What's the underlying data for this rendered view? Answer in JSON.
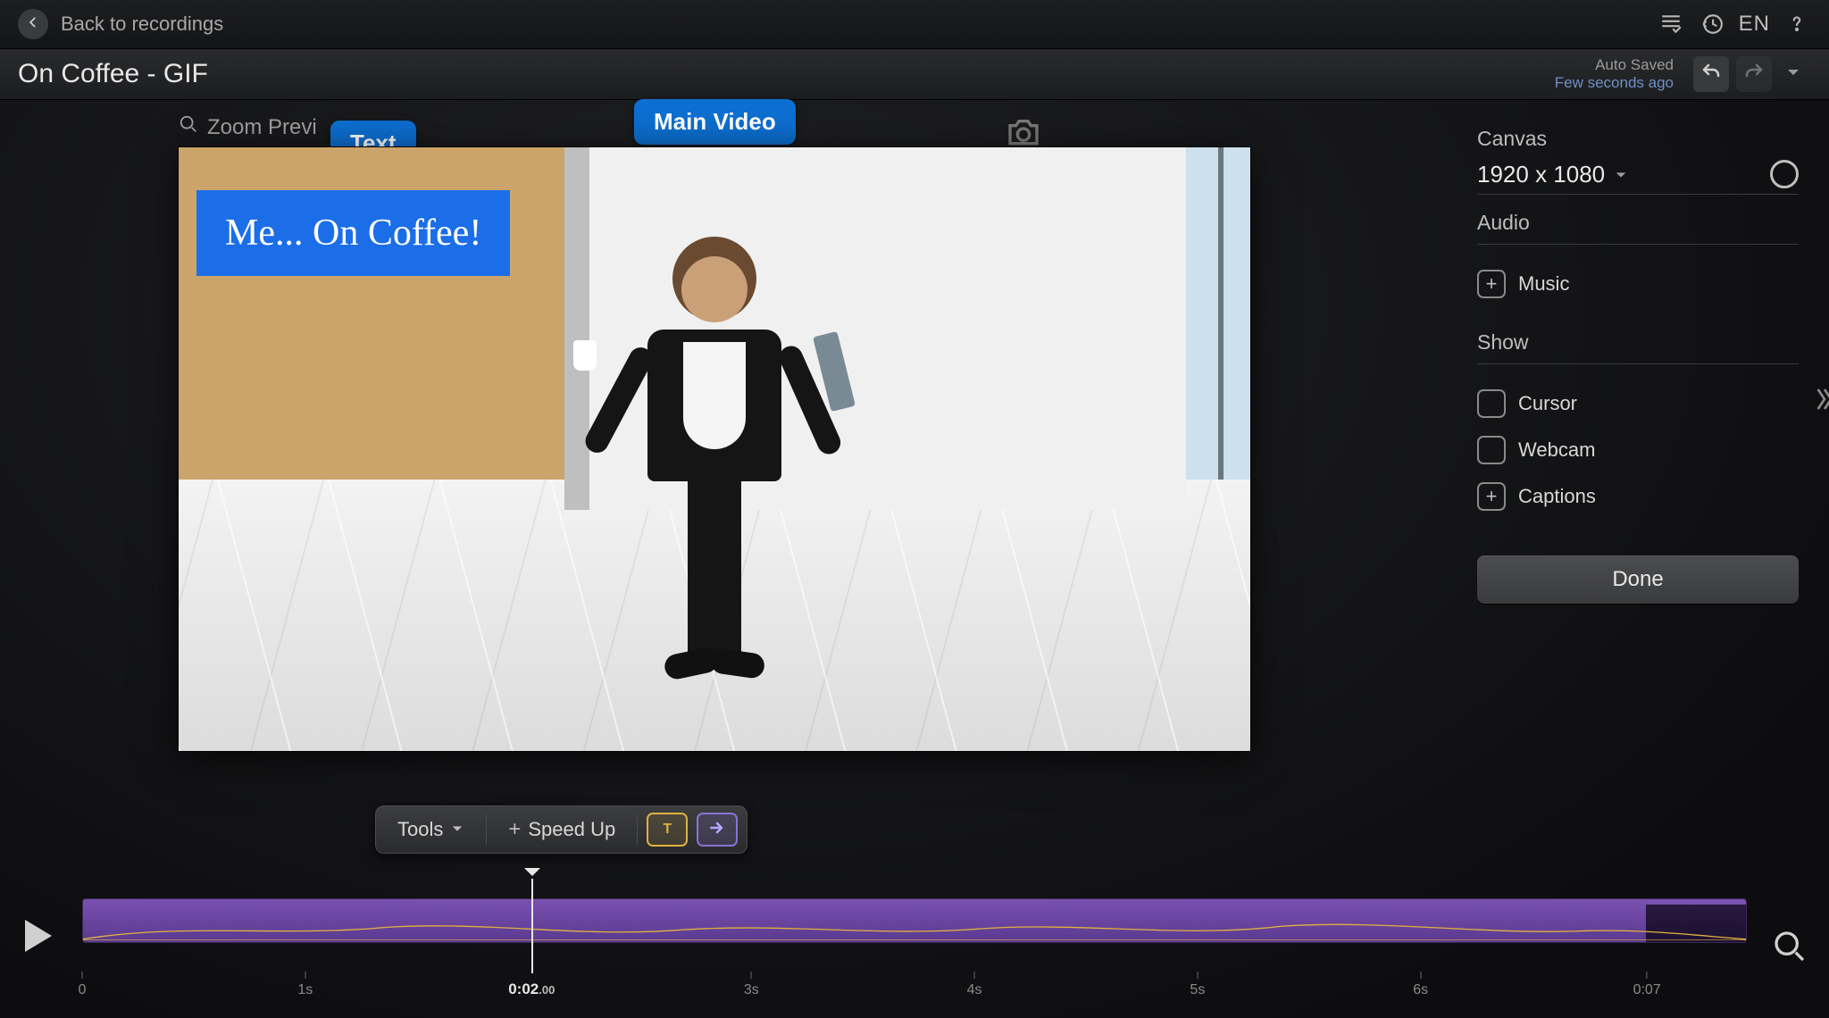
{
  "appbar": {
    "back_label": "Back to recordings",
    "language": "EN"
  },
  "titlebar": {
    "document_title": "On Coffee - GIF",
    "autosave_line1": "Auto Saved",
    "autosave_line2": "Few seconds ago"
  },
  "stage": {
    "zoom_label": "Zoom Previ",
    "callouts": {
      "text": "Text",
      "main_video": "Main Video"
    },
    "text_overlay": "Me... On Coffee!"
  },
  "side_panel": {
    "canvas_title": "Canvas",
    "canvas_value": "1920 x 1080",
    "audio_title": "Audio",
    "audio_music": "Music",
    "show_title": "Show",
    "show_cursor": "Cursor",
    "show_webcam": "Webcam",
    "show_captions": "Captions",
    "done": "Done"
  },
  "toolsbar": {
    "tools": "Tools",
    "speed_up": "Speed Up",
    "text_chip": "T"
  },
  "timeline": {
    "playhead_time_main": "0:02",
    "playhead_time_ms": ".00",
    "duration_label": "0:07",
    "fill_percent": 94,
    "playhead_percent": 27,
    "ticks": [
      {
        "label": "0",
        "percent": 0
      },
      {
        "label": "1s",
        "percent": 13.4
      },
      {
        "label": "3s",
        "percent": 40.2
      },
      {
        "label": "4s",
        "percent": 53.6
      },
      {
        "label": "5s",
        "percent": 67.0
      },
      {
        "label": "6s",
        "percent": 80.4
      },
      {
        "label": "0:07",
        "percent": 94
      }
    ]
  }
}
